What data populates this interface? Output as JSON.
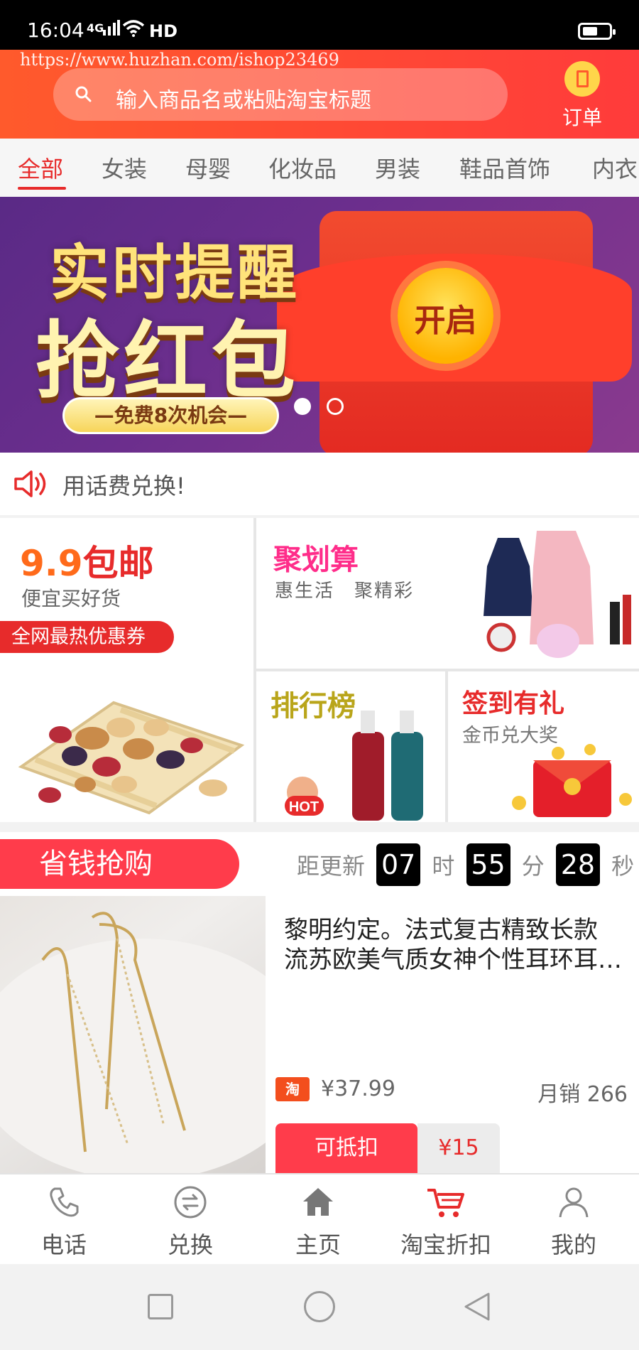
{
  "status_bar": {
    "time": "16:04",
    "network": "4G",
    "hd": "HD"
  },
  "header": {
    "watermark": "https://www.huzhan.com/ishop23469",
    "search_placeholder": "输入商品名或粘贴淘宝标题",
    "order_label": "订单"
  },
  "tabs": [
    {
      "label": "全部",
      "active": true
    },
    {
      "label": "女装"
    },
    {
      "label": "母婴"
    },
    {
      "label": "化妆品"
    },
    {
      "label": "男装"
    },
    {
      "label": "鞋品首饰"
    },
    {
      "label": "内衣"
    }
  ],
  "banner": {
    "title_line1": "实时提醒",
    "title_line2": "抢红包",
    "pill": "—免费8次机会—",
    "open_button": "开启",
    "slide_index": 1,
    "slide_count": 2
  },
  "notice": {
    "text": "用话费兑换!"
  },
  "promo_grid": {
    "cheap": {
      "title_num": "9.9",
      "title_text": "包邮",
      "subtitle": "便宜买好货",
      "tag": "全网最热优惠券"
    },
    "juhuasuan": {
      "title": "聚划算",
      "subtitle": "惠生活　聚精彩"
    },
    "ranking": {
      "title": "排行榜",
      "badge": "HOT"
    },
    "signin": {
      "title": "签到有礼",
      "subtitle": "金币兑大奖"
    }
  },
  "flash_sale": {
    "label": "省钱抢购",
    "countdown_prefix": "距更新",
    "hours": "07",
    "hours_unit": "时",
    "minutes": "55",
    "minutes_unit": "分",
    "seconds": "28",
    "seconds_unit": "秒",
    "product": {
      "title_line1": "黎明约定。法式复古精致长款",
      "title_line2": "流苏欧美气质女神个性耳环耳…",
      "source_badge": "淘",
      "price": "¥37.99",
      "monthly_sales": "月销 266",
      "deduct_label": "可抵扣",
      "deduct_value": "¥15"
    }
  },
  "bottom_nav": [
    {
      "label": "电话",
      "icon": "phone-icon"
    },
    {
      "label": "兑换",
      "icon": "exchange-icon"
    },
    {
      "label": "主页",
      "icon": "home-icon"
    },
    {
      "label": "淘宝折扣",
      "icon": "cart-icon",
      "active": true
    },
    {
      "label": "我的",
      "icon": "user-icon"
    }
  ],
  "colors": {
    "accent": "#e72b2b",
    "header_start": "#ff5a2c",
    "header_end": "#ff3b3b",
    "flash": "#ff3c4b"
  }
}
